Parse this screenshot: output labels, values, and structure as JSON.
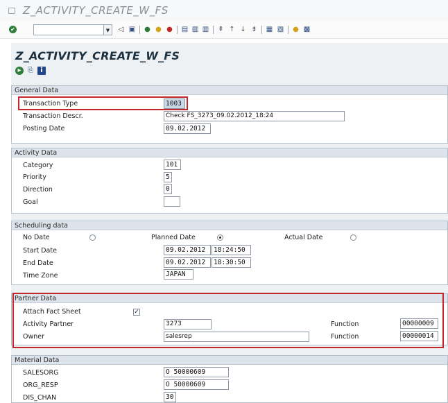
{
  "window": {
    "title": "Z_ACTIVITY_CREATE_W_FS"
  },
  "toolbar": {
    "command_value": ""
  },
  "screen": {
    "title": "Z_ACTIVITY_CREATE_W_FS"
  },
  "general": {
    "header": "General Data",
    "transaction_type_label": "Transaction Type",
    "transaction_type_value": "1003",
    "transaction_descr_label": "Transaction Descr.",
    "transaction_descr_value": "Check FS_3273_09.02.2012_18:24",
    "posting_date_label": "Posting Date",
    "posting_date_value": "09.02.2012"
  },
  "activity": {
    "header": "Activity Data",
    "category_label": "Category",
    "category_value": "101",
    "priority_label": "Priority",
    "priority_value": "5",
    "direction_label": "Direction",
    "direction_value": "0",
    "goal_label": "Goal",
    "goal_value": ""
  },
  "scheduling": {
    "header": "Scheduling data",
    "no_date_label": "No Date",
    "planned_date_label": "Planned Date",
    "actual_date_label": "Actual Date",
    "selected_option": "Planned Date",
    "start_date_label": "Start Date",
    "start_date_value": "09.02.2012",
    "start_time_value": "18:24:50",
    "end_date_label": "End Date",
    "end_date_value": "09.02.2012",
    "end_time_value": "18:30:50",
    "time_zone_label": "Time Zone",
    "time_zone_value": "JAPAN"
  },
  "partner": {
    "header": "Partner Data",
    "attach_fact_sheet_label": "Attach Fact Sheet",
    "attach_fact_sheet_checked": "✓",
    "activity_partner_label": "Activity Partner",
    "activity_partner_value": "3273",
    "activity_partner_function_label": "Function",
    "activity_partner_function_value": "00000009",
    "owner_label": "Owner",
    "owner_value": "salesrep",
    "owner_function_label": "Function",
    "owner_function_value": "00000014"
  },
  "material": {
    "header": "Material Data",
    "salesorg_label": "SALESORG",
    "salesorg_value": "O 50000609",
    "org_resp_label": "ORG_RESP",
    "org_resp_value": "O 50000609",
    "dis_chan_label": "DIS_CHAN",
    "dis_chan_value": "30"
  },
  "colors": {
    "highlight": "#c4262e",
    "group_header": "#dde3ea",
    "title": "#1d3140"
  },
  "icons": [
    "window-menu-icon",
    "enter-icon",
    "save-icon",
    "back-icon",
    "exit-icon",
    "cancel-icon",
    "print-icon",
    "find-icon",
    "find-next-icon",
    "first-page-icon",
    "prev-page-icon",
    "next-page-icon",
    "last-page-icon",
    "create-session-icon",
    "shortcut-icon",
    "help-icon",
    "layout-icon",
    "execute-icon",
    "copy-icon",
    "info-icon"
  ]
}
